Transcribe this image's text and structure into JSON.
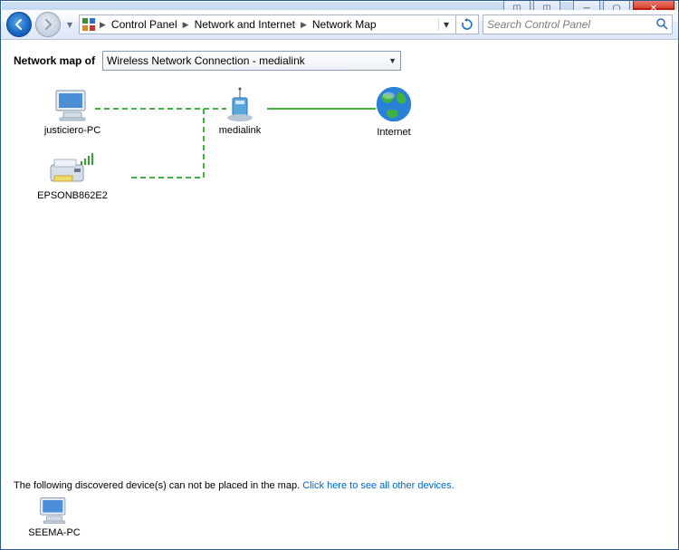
{
  "breadcrumb": {
    "seg1": "Control Panel",
    "seg2": "Network and Internet",
    "seg3": "Network Map"
  },
  "search": {
    "placeholder": "Search Control Panel"
  },
  "map_of": {
    "label": "Network map of",
    "selected": "Wireless Network Connection - medialink"
  },
  "nodes": {
    "pc1": "justiciero-PC",
    "router": "medialink",
    "internet": "Internet",
    "printer": "EPSONB862E2",
    "unplaced": "SEEMA-PC"
  },
  "footer": {
    "text": "The following discovered device(s) can not be placed in the map.",
    "link": "Click here to see all other devices."
  },
  "win": {
    "min": "─",
    "max": "▢",
    "close": "✕",
    "help": "?",
    "extra": "◫"
  }
}
